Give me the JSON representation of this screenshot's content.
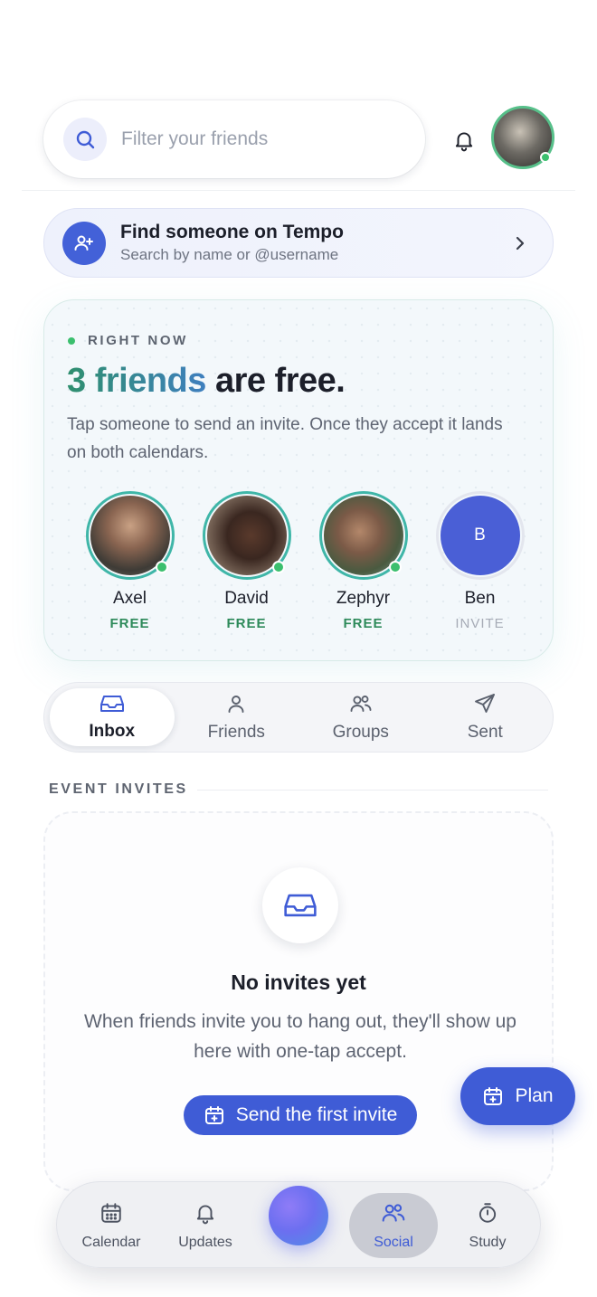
{
  "search": {
    "placeholder": "Filter your friends"
  },
  "find_banner": {
    "title": "Find someone on Tempo",
    "subtitle": "Search by name or @username"
  },
  "right_now": {
    "label": "RIGHT NOW",
    "title_accent": "3 friends",
    "title_rest": " are free.",
    "description": "Tap someone to send an invite. Once they accept it lands on both calendars.",
    "friends": [
      {
        "name": "Axel",
        "status": "FREE"
      },
      {
        "name": "David",
        "status": "FREE"
      },
      {
        "name": "Zephyr",
        "status": "FREE"
      },
      {
        "name": "Ben",
        "status": "INVITE",
        "initial": "B"
      }
    ]
  },
  "tabs": [
    {
      "label": "Inbox",
      "icon": "inbox-icon",
      "active": true
    },
    {
      "label": "Friends",
      "icon": "user-icon"
    },
    {
      "label": "Groups",
      "icon": "users-icon"
    },
    {
      "label": "Sent",
      "icon": "send-icon"
    }
  ],
  "event_invites": {
    "section_label": "EVENT INVITES",
    "empty_title": "No invites yet",
    "empty_description": "When friends invite you to hang out, they'll show up here with one-tap accept.",
    "cta_label": "Send the first invite"
  },
  "plan_button": {
    "label": "Plan"
  },
  "bottom_nav": [
    {
      "label": "Calendar",
      "icon": "calendar-icon"
    },
    {
      "label": "Updates",
      "icon": "bell-icon"
    },
    {
      "label": "Social",
      "icon": "users-icon",
      "active": true
    },
    {
      "label": "Study",
      "icon": "stopwatch-icon"
    }
  ],
  "colors": {
    "accent": "#3f5cd6",
    "online": "#3bbf6e",
    "free": "#2d8a5a"
  }
}
